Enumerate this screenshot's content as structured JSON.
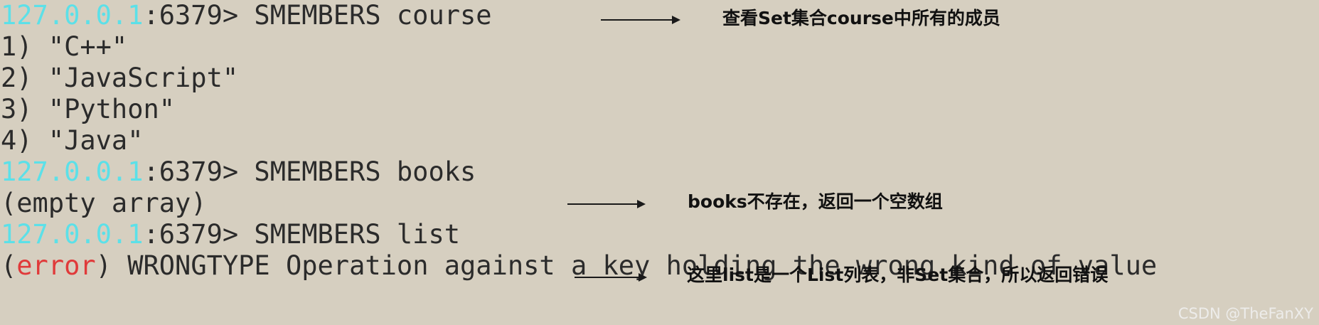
{
  "terminal": {
    "prompt_ip": "127.0.0.1",
    "prompt_suffix": ":6379> ",
    "cmd_course": "SMEMBERS course",
    "course_members": [
      "1) \"C++\"",
      "2) \"JavaScript\"",
      "3) \"Python\"",
      "4) \"Java\""
    ],
    "cmd_books": "SMEMBERS books",
    "books_result": "(empty array)",
    "cmd_list": "SMEMBERS list",
    "error_open": "(",
    "error_word": "error",
    "error_rest": ") WRONGTYPE Operation against a key holding the wrong kind of value"
  },
  "annotations": {
    "course": "查看Set集合course中所有的成员",
    "books": "books不存在，返回一个空数组",
    "list": "这里list是一个List列表，非Set集合，所以返回错误"
  },
  "watermark": "CSDN @TheFanXY",
  "colors": {
    "background": "#d6cfc0",
    "text": "#2b2b2b",
    "prompt_ip": "#5ce0e8",
    "error": "#e03a3a"
  }
}
